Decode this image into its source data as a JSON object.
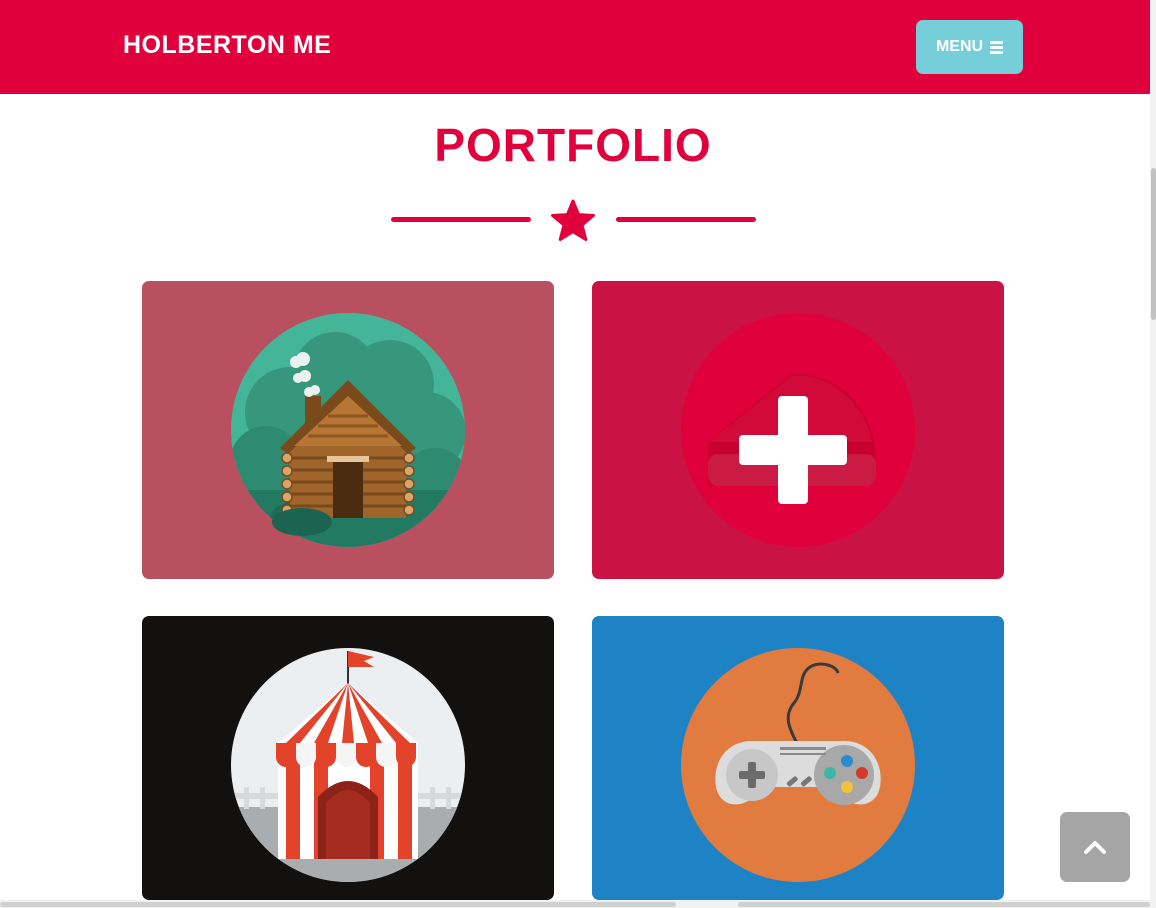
{
  "nav": {
    "brand": "HOLBERTON ME",
    "menu_label": "MENU",
    "menu_icon": "bars-icon"
  },
  "portfolio": {
    "title": "PORTFOLIO",
    "divider_icon": "star-icon",
    "items": [
      {
        "name": "cabin",
        "icon": "cabin-icon",
        "background": "#b8505f",
        "circle": "#3fa98c"
      },
      {
        "name": "cake",
        "icon": "cake-plus-icon",
        "background": "#cb1244",
        "circle": "#e0003c"
      },
      {
        "name": "circus",
        "icon": "circus-tent-icon",
        "background": "#131010",
        "circle": "#eceff1"
      },
      {
        "name": "game",
        "icon": "game-controller-icon",
        "background": "#1e83c4",
        "circle": "#e27b3f"
      }
    ]
  },
  "scroll_top": {
    "icon": "chevron-up-icon"
  },
  "colors": {
    "primary": "#e0003c",
    "accent": "#76cfd8"
  }
}
